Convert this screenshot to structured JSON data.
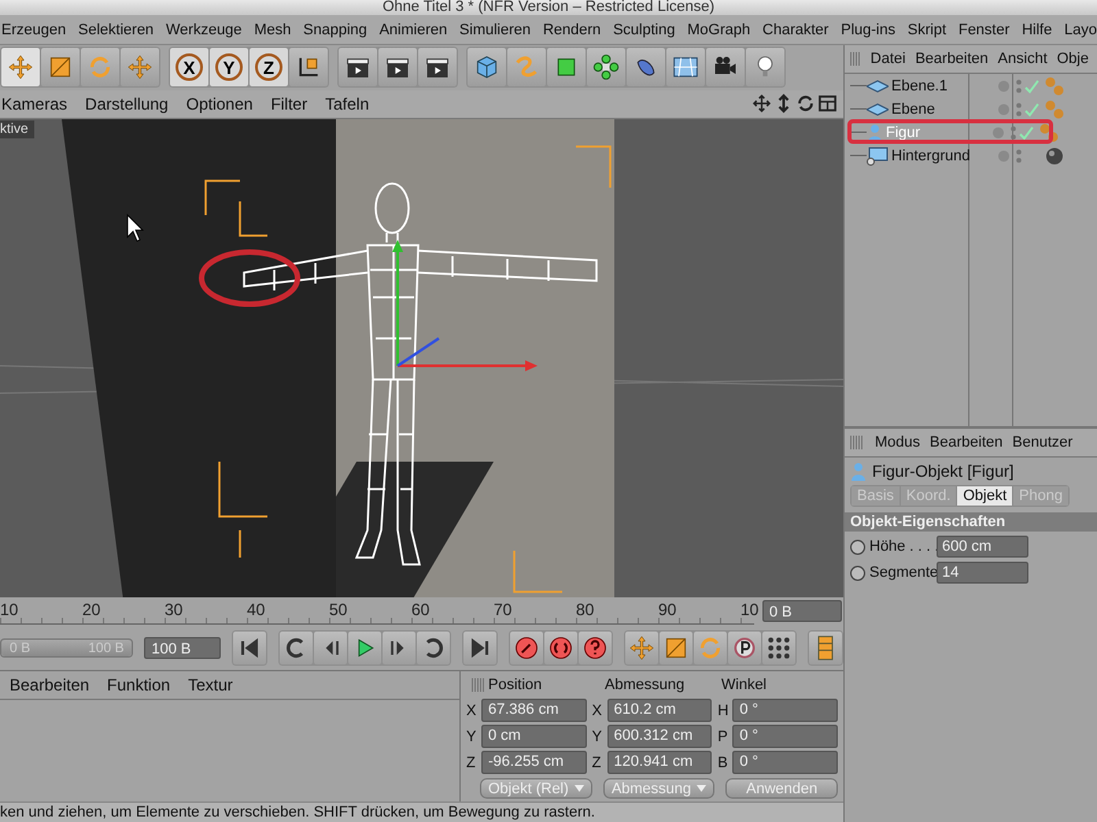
{
  "window": {
    "title": "Ohne Titel 3 * (NFR Version – Restricted License)"
  },
  "menu": [
    "Erzeugen",
    "Selektieren",
    "Werkzeuge",
    "Mesh",
    "Snapping",
    "Animieren",
    "Simulieren",
    "Rendern",
    "Sculpting",
    "MoGraph",
    "Charakter",
    "Plug-ins",
    "Skript",
    "Fenster",
    "Hilfe",
    "Layo"
  ],
  "toolbar": {
    "axes": [
      "X",
      "Y",
      "Z"
    ]
  },
  "viewport": {
    "menu": [
      "Kameras",
      "Darstellung",
      "Optionen",
      "Filter",
      "Tafeln"
    ],
    "view_label": "ktive"
  },
  "timeline": {
    "ticks": [
      "10",
      "20",
      "30",
      "40",
      "50",
      "60",
      "70",
      "80",
      "90",
      "10"
    ],
    "frame_field": "0 B"
  },
  "transport": {
    "range_start": "0 B",
    "range_end": "100 B",
    "level": 1,
    "end_field": "100 B"
  },
  "materials": {
    "menu": [
      "Bearbeiten",
      "Funktion",
      "Textur"
    ]
  },
  "coordinates": {
    "headers": [
      "Position",
      "Abmessung",
      "Winkel"
    ],
    "rows": [
      [
        {
          "axis": "X",
          "value": "67.386 cm"
        },
        {
          "axis": "X",
          "value": "610.2 cm"
        },
        {
          "axis": "H",
          "value": "0 °"
        }
      ],
      [
        {
          "axis": "Y",
          "value": "0 cm"
        },
        {
          "axis": "Y",
          "value": "600.312 cm"
        },
        {
          "axis": "P",
          "value": "0 °"
        }
      ],
      [
        {
          "axis": "Z",
          "value": "-96.255 cm"
        },
        {
          "axis": "Z",
          "value": "120.941 cm"
        },
        {
          "axis": "B",
          "value": "0 °"
        }
      ]
    ],
    "dropdowns": [
      "Objekt (Rel)",
      "Abmessung"
    ],
    "apply_button": "Anwenden"
  },
  "status_bar": "ken und ziehen, um Elemente zu verschieben. SHIFT drücken, um Bewegung zu rastern.",
  "object_manager": {
    "menu": [
      "Datei",
      "Bearbeiten",
      "Ansicht",
      "Obje"
    ],
    "objects": [
      {
        "name": "Ebene.1",
        "kind": "plane",
        "selected": false,
        "checked": true,
        "annotated": false
      },
      {
        "name": "Ebene",
        "kind": "plane",
        "selected": false,
        "checked": true,
        "annotated": false
      },
      {
        "name": "Figur",
        "kind": "figure",
        "selected": true,
        "checked": true,
        "annotated": true
      },
      {
        "name": "Hintergrund",
        "kind": "background",
        "selected": false,
        "checked": false,
        "annotated": false
      }
    ]
  },
  "attributes": {
    "menu": [
      "Modus",
      "Bearbeiten",
      "Benutzer"
    ],
    "object_title": "Figur-Objekt [Figur]",
    "tabs": [
      {
        "label": "Basis",
        "selected": false
      },
      {
        "label": "Koord.",
        "selected": false
      },
      {
        "label": "Objekt",
        "selected": true
      },
      {
        "label": "Phong",
        "selected": false
      }
    ],
    "section": "Objekt-Eigenschaften",
    "fields": [
      {
        "label": "Höhe",
        "leader": ". . . .",
        "value": "600 cm",
        "checked": false
      },
      {
        "label": "Segmente",
        "value": "14",
        "checked": false
      }
    ]
  }
}
